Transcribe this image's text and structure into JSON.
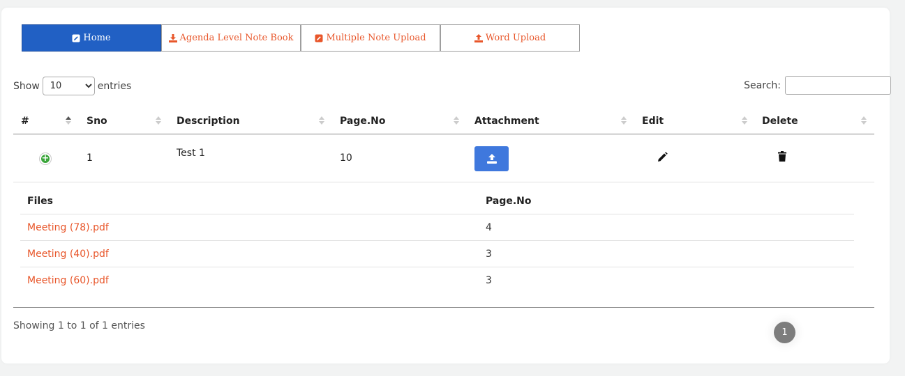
{
  "tabs": [
    {
      "label": "Home",
      "icon": "edit-icon"
    },
    {
      "label": "Agenda Level Note Book",
      "icon": "download-icon"
    },
    {
      "label": "Multiple Note Upload",
      "icon": "edit-icon"
    },
    {
      "label": "Word Upload",
      "icon": "upload-icon"
    }
  ],
  "length": {
    "show_label": "Show",
    "value": "10",
    "entries_label": "entries"
  },
  "search": {
    "label": "Search:",
    "value": ""
  },
  "columns": [
    "#",
    "Sno",
    "Description",
    "Page.No",
    "Attachment",
    "Edit",
    "Delete"
  ],
  "rows": [
    {
      "sno": "1",
      "description": "Test 1",
      "page_no": "10"
    }
  ],
  "files": {
    "headers": [
      "Files",
      "Page.No"
    ],
    "items": [
      {
        "name": "Meeting (78).pdf",
        "page": "4"
      },
      {
        "name": "Meeting (40).pdf",
        "page": "3"
      },
      {
        "name": "Meeting (60).pdf",
        "page": "3"
      }
    ]
  },
  "info": "Showing 1 to 1 of 1 entries",
  "pagination": {
    "current": "1"
  },
  "colors": {
    "primary": "#2160c4",
    "accent": "#e8562a",
    "upload_btn": "#3f78dd",
    "expand": "#3aa53a"
  }
}
